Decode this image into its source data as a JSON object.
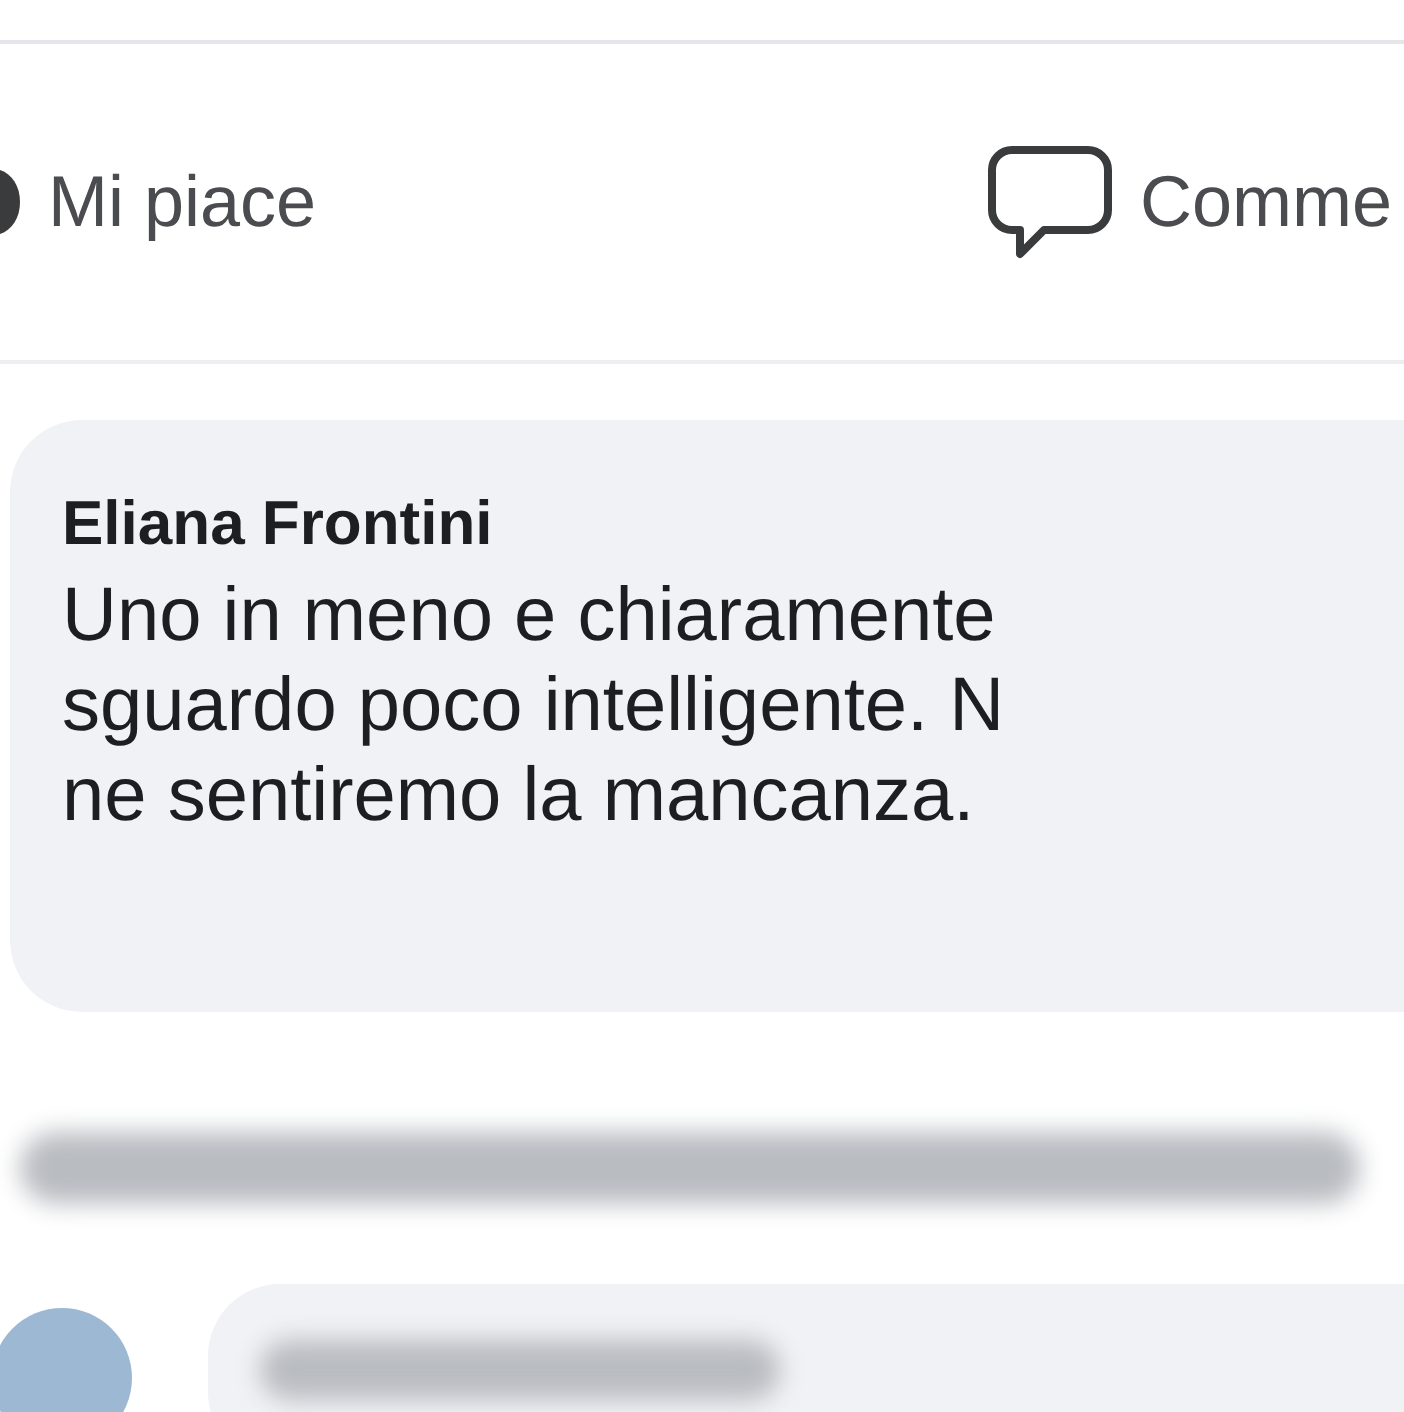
{
  "actions": [
    {
      "label": "Mi piace",
      "kind": "like"
    },
    {
      "label": "Comme",
      "kind": "comment"
    }
  ],
  "comment": {
    "author": "Eliana Frontini",
    "lines": [
      "Uno in meno e chiaramente",
      "sguardo poco intelligente. N",
      "ne sentiremo la mancanza."
    ]
  }
}
